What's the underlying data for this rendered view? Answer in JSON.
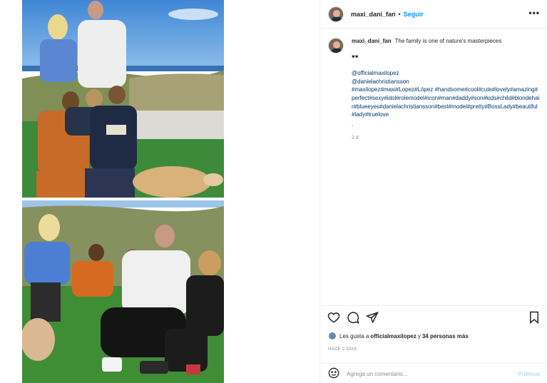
{
  "post": {
    "username": "maxi_dani_fan",
    "separator": "•",
    "follow_label": "Seguir",
    "more_label": "•••"
  },
  "caption": {
    "username": "maxi_dani_fan",
    "text": "The family is one of nature's masterpieces",
    "hearts": "♥♥",
    "mention1": "@officialmaxilopez",
    "mention2": "@danielachristiansson",
    "hashtags": "#maxilopez#maxi#Lopez#López #handsome#cool#cute#lovely#amazing#perfect#sexy#idol#rolemodel#icon#man#daddy#son#kids#child#blondehair#blueeyes#danielachristiansson#best#model#pretty#BossLady#beautiful#lady#truelove",
    "dot": ".",
    "age": "2 d"
  },
  "actions": {
    "likes_prefix": "Les gusta a",
    "likes_user": "officialmaxilopez",
    "likes_middle": "y",
    "likes_others": "34 personas más",
    "timestamp": "HACE 2 DÍAS"
  },
  "comment": {
    "placeholder": "Agrega un comentario...",
    "publish_label": "Publicar"
  },
  "icons": [
    "heart-icon",
    "comment-icon",
    "share-icon",
    "bookmark-icon",
    "emoji-icon",
    "more-icon"
  ],
  "colors": {
    "link": "#0095f6",
    "mention": "#00376b",
    "muted": "#8e8e8e"
  }
}
